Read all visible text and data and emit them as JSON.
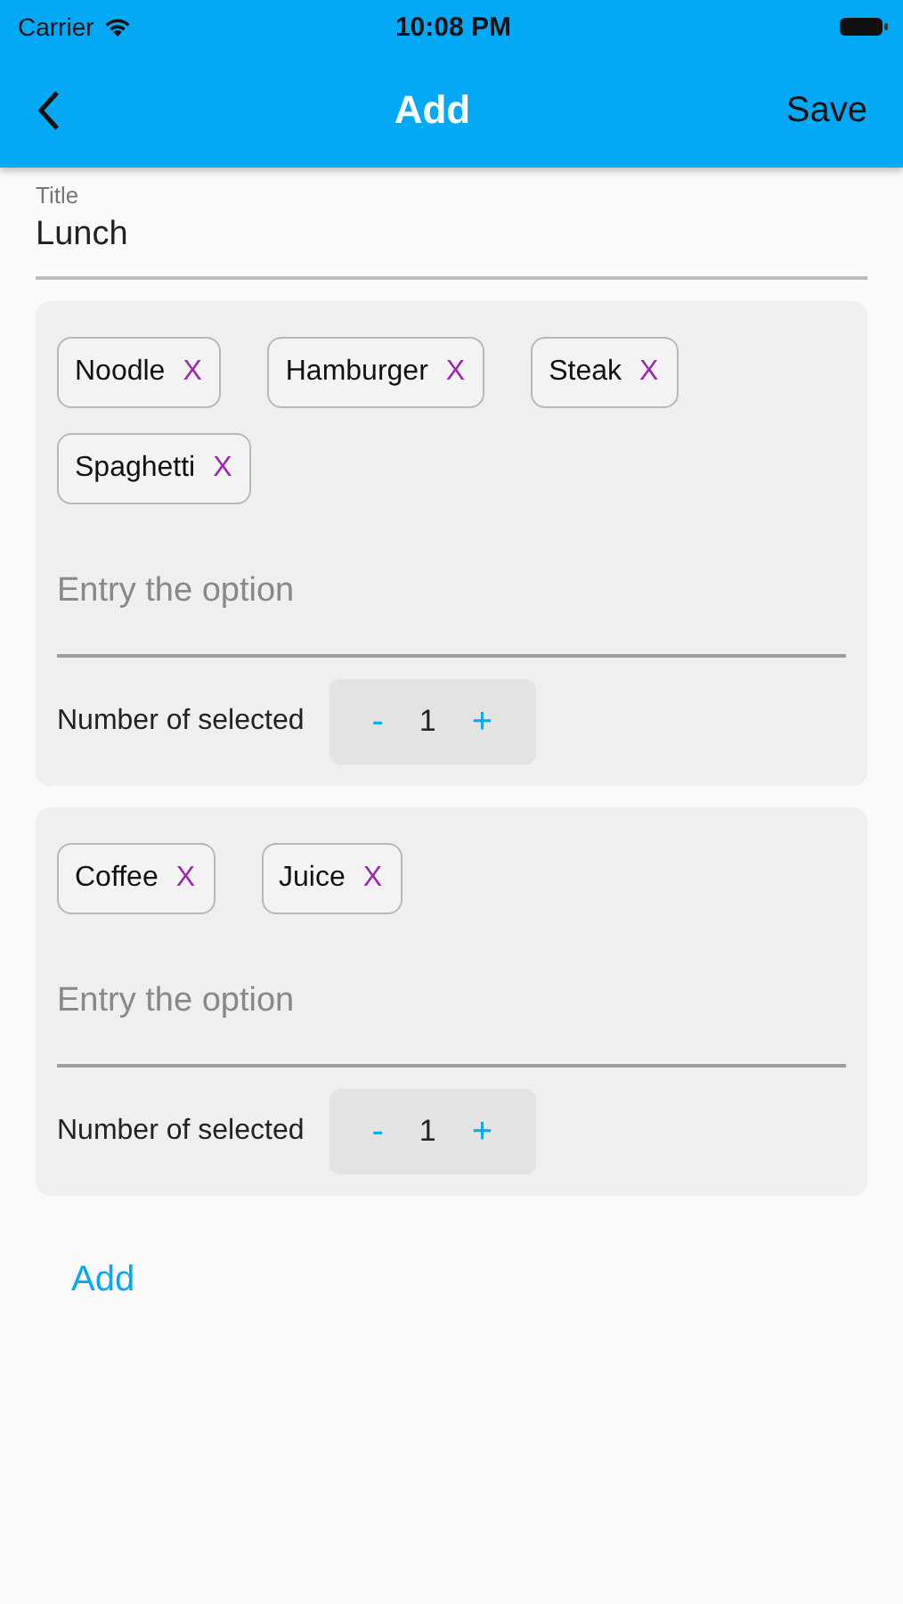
{
  "status_bar": {
    "carrier": "Carrier",
    "time": "10:08 PM"
  },
  "nav_bar": {
    "title": "Add",
    "action": "Save"
  },
  "title_field": {
    "label": "Title",
    "value": "Lunch"
  },
  "groups": [
    {
      "options": [
        {
          "label": "Noodle",
          "remove": "X"
        },
        {
          "label": "Hamburger",
          "remove": "X"
        },
        {
          "label": "Steak",
          "remove": "X"
        },
        {
          "label": "Spaghetti",
          "remove": "X"
        }
      ],
      "placeholder": "Entry the option",
      "count_label": "Number of selected",
      "minus": "-",
      "count": "1",
      "plus": "+"
    },
    {
      "options": [
        {
          "label": "Coffee",
          "remove": "X"
        },
        {
          "label": "Juice",
          "remove": "X"
        }
      ],
      "placeholder": "Entry the option",
      "count_label": "Number of selected",
      "minus": "-",
      "count": "1",
      "plus": "+"
    }
  ],
  "add_button": "Add"
}
